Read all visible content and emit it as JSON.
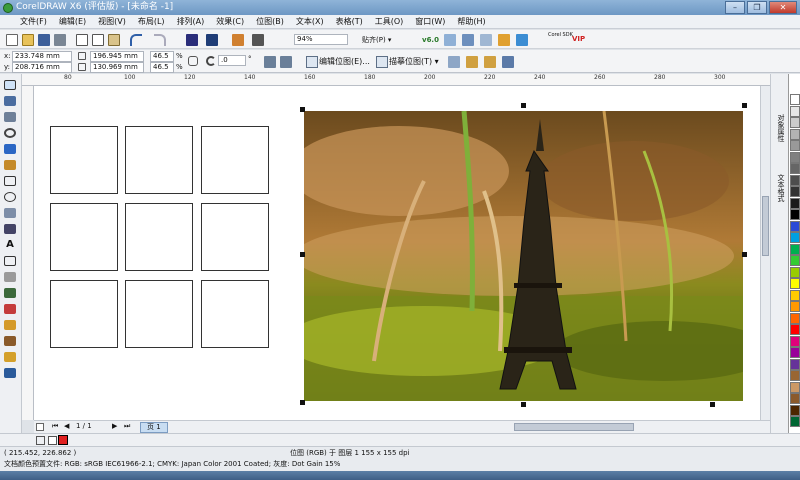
{
  "window": {
    "title": "CorelDRAW X6 (评估版) - [未命名 -1]",
    "controls": {
      "minimize": "–",
      "restore": "❐",
      "close": "✕"
    }
  },
  "menu": [
    "文件(F)",
    "编辑(E)",
    "视图(V)",
    "布局(L)",
    "排列(A)",
    "效果(C)",
    "位图(B)",
    "文本(X)",
    "表格(T)",
    "工具(O)",
    "窗口(W)",
    "帮助(H)"
  ],
  "toolbar": {
    "zoom": "94%",
    "snap": "贴齐(P) ▾",
    "version_badge": "v6.0",
    "corel_badge": "Corel SDK",
    "vip_badge": "VIP"
  },
  "propertybar": {
    "x_label": "x:",
    "x_value": "233.748 mm",
    "y_label": "y:",
    "y_value": "208.716 mm",
    "w_value": "196.945 mm",
    "h_value": "130.969 mm",
    "scale_x": "46.5",
    "scale_y": "46.5",
    "percent_x": "%",
    "percent_y": "%",
    "rotation": ".0",
    "rotation_unit": "°",
    "edit_bitmap": "编辑位图(E)...",
    "trace_bitmap": "描摹位图(T) ▾"
  },
  "ruler": {
    "top_ticks": [
      "80",
      "100",
      "120",
      "140",
      "160",
      "180",
      "200",
      "220",
      "240",
      "260",
      "280",
      "300"
    ]
  },
  "pages": {
    "current": "1 / 1",
    "tab": "页 1"
  },
  "docker_tabs": [
    "对象属性",
    "文本格式"
  ],
  "status": {
    "coords": "( 215.452, 226.862 )",
    "object_info": "位图 (RGB) 于 图层 1 155 x 155 dpi",
    "color_profile": "文档颜色预置文件: RGB: sRGB IEC61966-2.1; CMYK: Japan Color 2001 Coated; 灰度: Dot Gain 15%"
  },
  "palette_colors": [
    "#ffffff",
    "#e6e6e6",
    "#cccccc",
    "#b3b3b3",
    "#999999",
    "#808080",
    "#666666",
    "#4d4d4d",
    "#333333",
    "#1a1a1a",
    "#000000",
    "#2b4bd6",
    "#00a0e0",
    "#00b050",
    "#33cc33",
    "#99cc00",
    "#ffff00",
    "#ffcc00",
    "#ff9900",
    "#ff6600",
    "#ff0000",
    "#e0007a",
    "#990099",
    "#663399",
    "#996633",
    "#cc9966",
    "#8b5a2b",
    "#4d2600",
    "#006633"
  ],
  "fill_indicator": {
    "fill": "#e02020",
    "outline": "#000000"
  }
}
